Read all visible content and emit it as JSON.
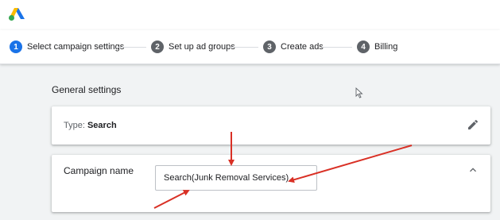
{
  "header": {
    "logo_icon": "google-ads-logo-icon"
  },
  "stepper": {
    "steps": [
      {
        "number": "1",
        "label": "Select campaign settings",
        "active": true
      },
      {
        "number": "2",
        "label": "Set up ad groups",
        "active": false
      },
      {
        "number": "3",
        "label": "Create ads",
        "active": false
      },
      {
        "number": "4",
        "label": "Billing",
        "active": false
      }
    ],
    "active_color": "#1a73e8",
    "inactive_color": "#5f6368"
  },
  "section": {
    "title": "General settings"
  },
  "type_card": {
    "prefix": "Type: ",
    "value": "Search",
    "edit_icon": "pencil-icon"
  },
  "name_card": {
    "label": "Campaign name",
    "input_value": "Search(Junk Removal Services)",
    "collapse_icon": "chevron-up-icon"
  },
  "annotations": {
    "arrow_color": "#d93025"
  }
}
